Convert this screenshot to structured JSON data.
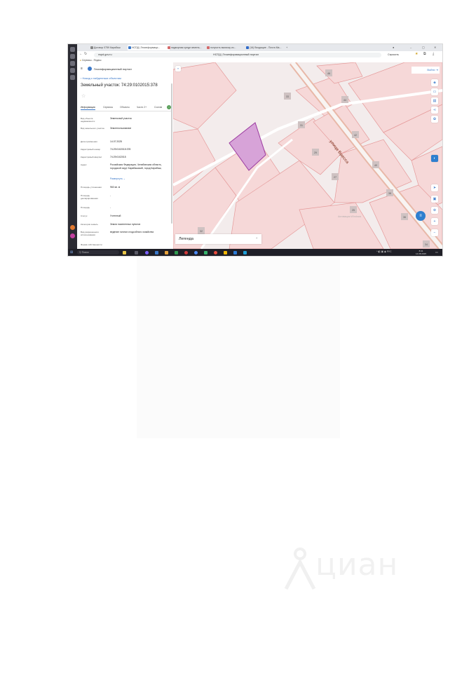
{
  "browser": {
    "tabs": [
      {
        "label": "Договор 0759 Карабаш",
        "color": "#888888",
        "active": false
      },
      {
        "label": "НСПД | Геоинформаци...",
        "color": "#3a78c9",
        "active": true
      },
      {
        "label": "надворная среди земель...",
        "color": "#d46a6a",
        "active": false
      },
      {
        "label": "получить выписку из...",
        "color": "#d46a6a",
        "active": false
      },
      {
        "label": "(16) Входящие - Почта Ма...",
        "color": "#2f6ac8",
        "active": false
      }
    ],
    "url": "nspd.gov.ru",
    "page_title": "НСПД | Геоинформационный портал",
    "addr_right": "Спросить",
    "bookmarks": "Сервисы - Яндекс"
  },
  "sidebar": {
    "portal_title": "Геоинформационный портал",
    "back_link": "Назад к найденным объектам",
    "object_title": "Земельный участок: 74:29:0102015:378",
    "tabs": [
      "Информация",
      "Сервисы",
      "Объекты",
      "Части 2+",
      "Состав"
    ],
    "fields": [
      {
        "label": "Вид объекта недвижимости",
        "value": "Земельный участок"
      },
      {
        "label": "Вид земельного участка",
        "value": "Землепользование"
      },
      {
        "label": "Дата присвоения",
        "value": "14.07.2025"
      },
      {
        "label": "Кадастровый номер",
        "value": "74:29:0102015:378"
      },
      {
        "label": "Кадастровый квартал",
        "value": "74:29:0102015"
      },
      {
        "label": "Адрес",
        "value": "Российская Федерация, Челябинская область, городской округ Карабашский, город Карабаш,"
      },
      {
        "label": "Площадь уточненная",
        "value": "960 кв. м"
      },
      {
        "label": "Площадь декларированная",
        "value": "-"
      },
      {
        "label": "Площадь",
        "value": "-"
      },
      {
        "label": "Статус",
        "value": "Учтенный"
      },
      {
        "label": "Категория земель",
        "value": "Земли населенных пунктов"
      },
      {
        "label": "Вид разрешенного использования",
        "value": "ведение личного подсобного хозяйства"
      },
      {
        "label": "Форма собственности",
        "value": ""
      }
    ],
    "expand_link": "Развернуть"
  },
  "map": {
    "login_label": "Войти",
    "street_label": "улица Бресса",
    "house_numbers": [
      "46",
      "44",
      "33",
      "31",
      "42",
      "29",
      "27",
      "40",
      "38",
      "25",
      "36",
      "32",
      "34"
    ],
    "legend_label": "Легенда",
    "faint_note": "Активация Windows"
  },
  "taskbar": {
    "search_placeholder": "Поиск",
    "clock_time": "8:41",
    "clock_date": "14.08.2025"
  },
  "watermark_text": "циан"
}
